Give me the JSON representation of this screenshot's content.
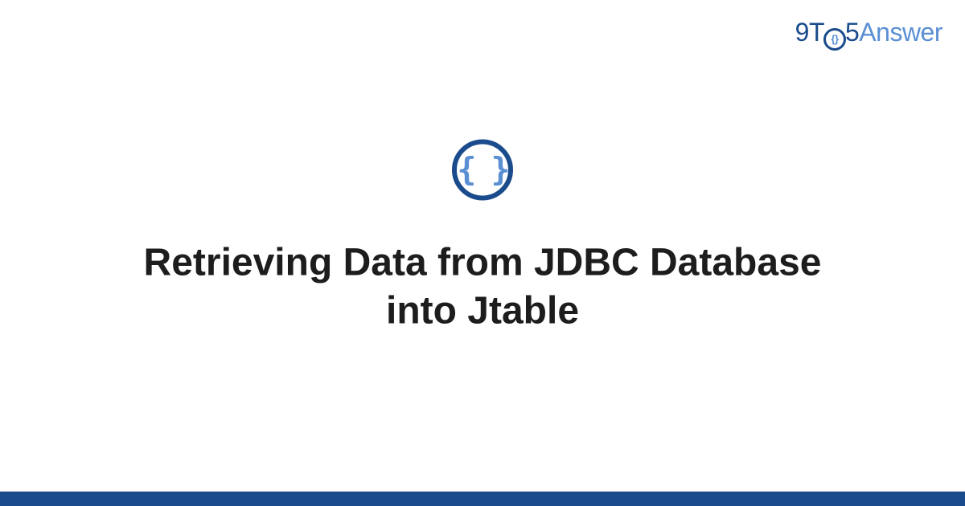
{
  "logo": {
    "part1": "9T",
    "clock_inner": "{}",
    "part2": "5",
    "part3": "Answer"
  },
  "icon": {
    "name": "code-braces-icon",
    "glyph": "{ }"
  },
  "title": "Retrieving Data from JDBC Database into Jtable",
  "colors": {
    "primary": "#1a4b8c",
    "secondary": "#5a8fd4",
    "text": "#1d1d1d"
  }
}
